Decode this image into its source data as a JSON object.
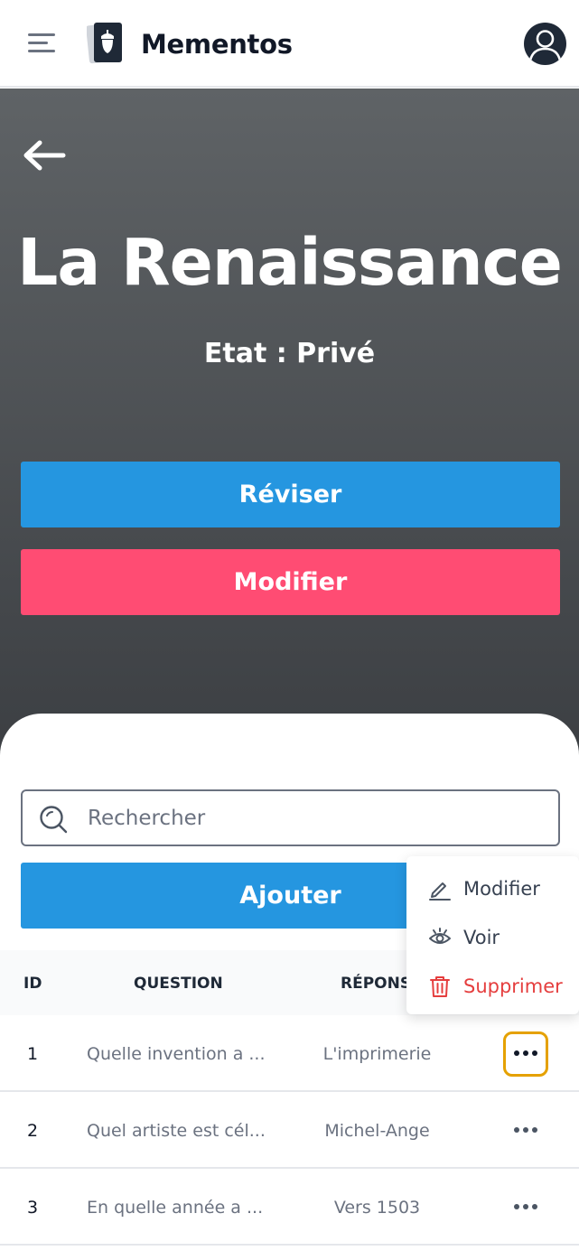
{
  "header": {
    "app_title": "Mementos",
    "menu_icon": "hamburger-menu-icon",
    "logo_icon": "mementos-acorn-cards-logo",
    "avatar_icon": "user-avatar-icon"
  },
  "hero": {
    "back_icon": "arrow-left-icon",
    "title": "La Renaissance",
    "state": "Etat : Privé",
    "review_label": "Réviser",
    "edit_label": "Modifier"
  },
  "search": {
    "placeholder": "Rechercher",
    "value": ""
  },
  "add_label": "Ajouter",
  "table": {
    "headers": [
      "ID",
      "QUESTION",
      "RÉPONSE"
    ],
    "rows": [
      {
        "id": "1",
        "question": "Quelle invention a ...",
        "answer": "L'imprimerie"
      },
      {
        "id": "2",
        "question": "Quel artiste est cél...",
        "answer": "Michel-Ange"
      },
      {
        "id": "3",
        "question": "En quelle année a ...",
        "answer": "Vers 1503"
      }
    ]
  },
  "row_menu": {
    "items": [
      {
        "label": "Modifier",
        "icon": "pencil-icon"
      },
      {
        "label": "Voir",
        "icon": "eye-icon"
      },
      {
        "label": "Supprimer",
        "icon": "trash-icon"
      }
    ]
  },
  "colors": {
    "primary_blue": "#2596e0",
    "edit_pink": "#ff4c73",
    "danger_red": "#e53e3e",
    "active_outline": "#e5a100",
    "hero_top": "#5f6366",
    "hero_bottom": "#3b3e42"
  }
}
